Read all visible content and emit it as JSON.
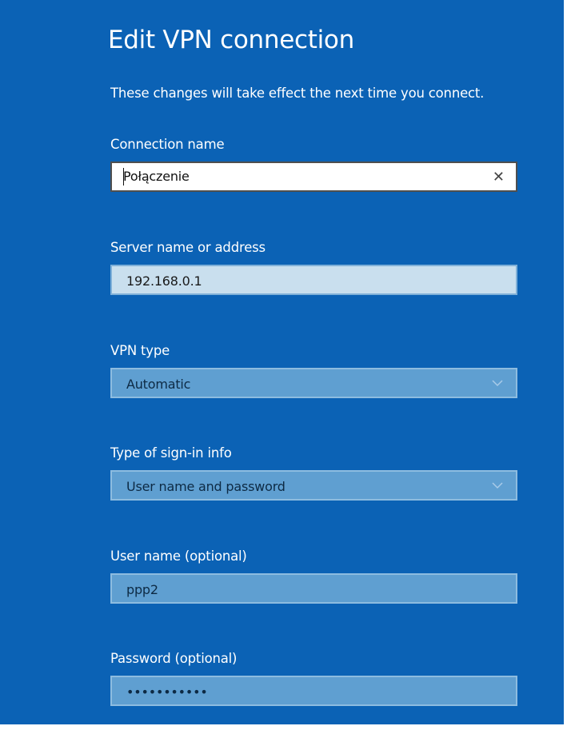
{
  "dialog": {
    "title": "Edit VPN connection",
    "subtitle": "These changes will take effect the next time you connect."
  },
  "fields": {
    "connection_name": {
      "label": "Connection name",
      "value": "Połączenie"
    },
    "server": {
      "label": "Server name or address",
      "value": "192.168.0.1"
    },
    "vpn_type": {
      "label": "VPN type",
      "value": "Automatic"
    },
    "sign_in_type": {
      "label": "Type of sign-in info",
      "value": "User name and password"
    },
    "user_name": {
      "label": "User name (optional)",
      "value": "ppp2"
    },
    "password": {
      "label": "Password (optional)",
      "value": "•••••••••••"
    }
  },
  "icons": {
    "clear": "close-icon",
    "dropdown": "chevron-down-icon"
  },
  "colors": {
    "background": "#0b62b5",
    "field_light": "#c9dfee",
    "field_blue": "#5f9fd1"
  }
}
